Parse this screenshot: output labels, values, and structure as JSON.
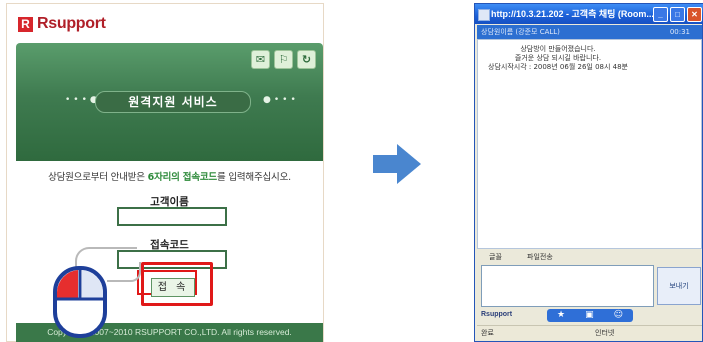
{
  "left_panel": {
    "logo_mark": "R",
    "logo_text": "Rsupport",
    "title": "원격지원 서비스",
    "instruction_prefix": "상담원으로부터 안내받은 ",
    "instruction_highlight": "6자리의 접속코드",
    "instruction_suffix": "를 입력해주십시오.",
    "customer_name_label": "고객이름",
    "access_code_label": "접속코드",
    "connect_label": "접 속",
    "footer": "Copyright©2007~2010 RSUPPORT CO.,LTD. All rights reserved."
  },
  "chat_window": {
    "title": "http://10.3.21.202 - 고객측 채팅 (Room...",
    "header_left": "상담원이름 (강준모 CALL)",
    "header_right": "00:31",
    "messages": [
      "상담방이 만들어졌습니다.",
      "즐거운 상담 되시길 바랍니다.",
      "상담시작시각 : 2008년 06월 26일 08시 48분"
    ],
    "toolbar_font": "글꼴",
    "toolbar_file": "파일전송",
    "send_label": "보내기",
    "brand": "Rsupport",
    "status_left": "완료",
    "status_right": "인터넷"
  }
}
